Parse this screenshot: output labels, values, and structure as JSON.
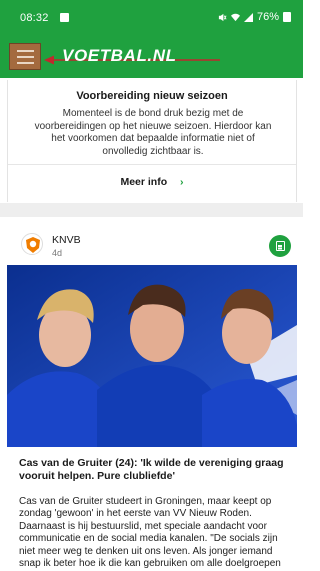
{
  "status_bar": {
    "time": "08:32",
    "battery": "76%",
    "icons": [
      "mute-icon",
      "wifi-icon",
      "signal-icon",
      "battery-icon"
    ]
  },
  "app_bar": {
    "logo": "VOETBAL.NL",
    "menu_icon": "hamburger-menu-icon",
    "colors": {
      "brand": "#1fa13f",
      "menu_highlight": "#a46a3e",
      "annotation_arrow": "#c0282d"
    }
  },
  "notice": {
    "title": "Voorbereiding nieuw seizoen",
    "text": "Momenteel is de bond druk bezig met de voorbereidingen op het nieuwe seizoen. Hierdoor kan het voorkomen dat bepaalde informatie niet of onvolledig zichtbaar is.",
    "more_label": "Meer info",
    "more_icon": "chevron-right-icon"
  },
  "post": {
    "author": "KNVB",
    "date": "4d",
    "share_icon": "article-icon",
    "headline": "Cas van de Gruiter (24): 'Ik wilde de vereniging graag vooruit helpen. Pure clubliefde'",
    "body": "Cas van de Gruiter studeert in Groningen, maar keept op zondag 'gewoon' in het eerste van VV Nieuw Roden. Daarnaast is hij bestuurslid, met speciale aandacht voor communicatie en de social media kanalen. \"De socials zijn niet meer weg te denken uit ons leven. Als jonger iemand snap ik beter hoe ik die kan gebruiken om alle doelgroepen"
  }
}
